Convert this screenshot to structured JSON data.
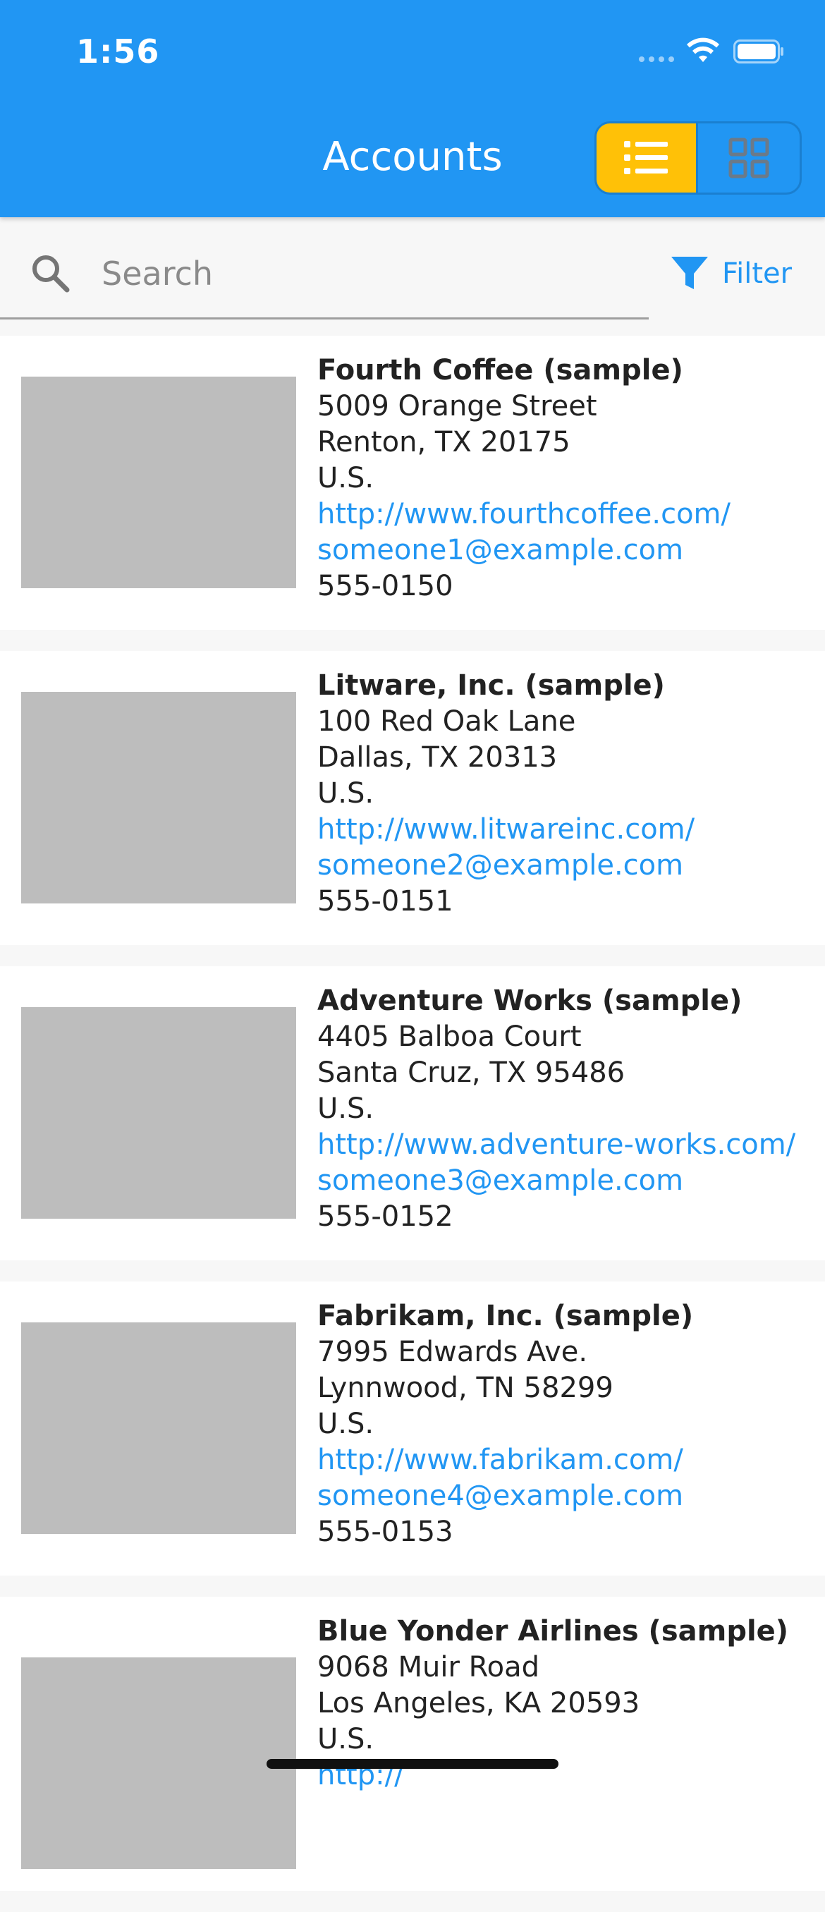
{
  "status_bar": {
    "time": "1:56"
  },
  "header": {
    "title": "Accounts",
    "view_toggle": {
      "active": "list",
      "options": [
        "list",
        "grid"
      ]
    }
  },
  "search": {
    "placeholder": "Search",
    "value": ""
  },
  "filter": {
    "label": "Filter"
  },
  "accounts": [
    {
      "name": "Fourth Coffee (sample)",
      "street": "5009 Orange Street",
      "city_line": "Renton, TX 20175",
      "country": "U.S.",
      "website": "http://www.fourthcoffee.com/",
      "email": "someone1@example.com",
      "phone": "555-0150"
    },
    {
      "name": "Litware, Inc. (sample)",
      "street": "100 Red Oak Lane",
      "city_line": "Dallas, TX 20313",
      "country": "U.S.",
      "website": "http://www.litwareinc.com/",
      "email": "someone2@example.com",
      "phone": "555-0151"
    },
    {
      "name": "Adventure Works (sample)",
      "street": "4405 Balboa Court",
      "city_line": "Santa Cruz, TX 95486",
      "country": "U.S.",
      "website": "http://www.adventure-works.com/",
      "email": "someone3@example.com",
      "phone": "555-0152"
    },
    {
      "name": "Fabrikam, Inc. (sample)",
      "street": "7995 Edwards Ave.",
      "city_line": "Lynnwood, TN 58299",
      "country": "U.S.",
      "website": "http://www.fabrikam.com/",
      "email": "someone4@example.com",
      "phone": "555-0153"
    },
    {
      "name": "Blue Yonder Airlines (sample)",
      "street": "9068 Muir Road",
      "city_line": "Los Angeles, KA 20593",
      "country": "U.S.",
      "website": "http://",
      "email": "",
      "phone": ""
    }
  ],
  "colors": {
    "app_bar": "#2196f3",
    "accent": "#2196f3",
    "toggle_active": "#ffc107",
    "image_placeholder": "#bdbdbd"
  },
  "icons": {
    "list_view": "list-icon",
    "grid_view": "grid-icon",
    "search": "search-icon",
    "filter": "filter-icon",
    "wifi": "wifi-icon",
    "battery": "battery-icon"
  }
}
